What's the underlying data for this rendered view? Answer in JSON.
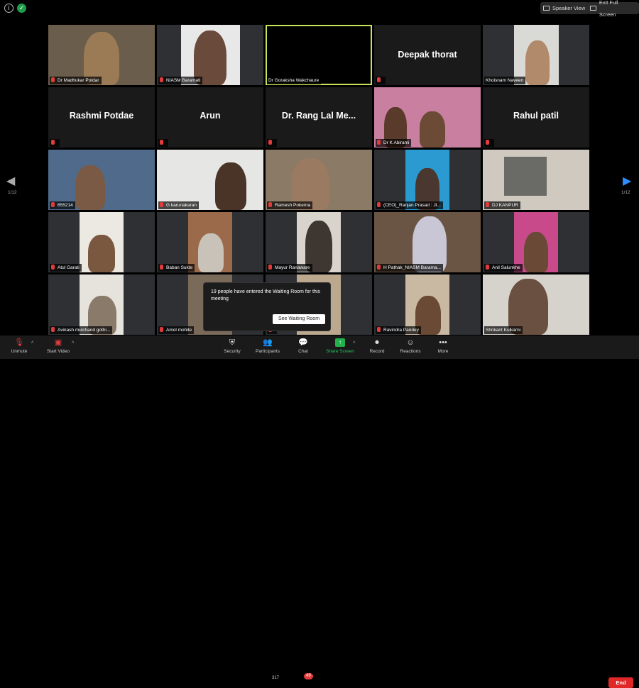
{
  "top": {
    "speaker_view": "Speaker View",
    "exit_full_screen": "Exit Full Screen"
  },
  "pagination": {
    "left_page": "1/12",
    "right_page": "1/12"
  },
  "tiles": [
    {
      "name": "Dr Madhukar Potdar",
      "kind": "video"
    },
    {
      "name": "NIASM Baramati",
      "kind": "video"
    },
    {
      "name": "Dr Goraksha Wakchaure",
      "kind": "black-active"
    },
    {
      "name": "Deepak thorat",
      "kind": "name-only"
    },
    {
      "name": "Khoisnam Naveen",
      "kind": "video"
    },
    {
      "name": "Rashmi Potdae",
      "kind": "name-only"
    },
    {
      "name": "Arun",
      "kind": "name-only"
    },
    {
      "name": "Dr. Rang Lal Me...",
      "kind": "name-only"
    },
    {
      "name": "Dr K Abirami",
      "kind": "video"
    },
    {
      "name": "Rahul patil",
      "kind": "name-only"
    },
    {
      "name": "655214",
      "kind": "video"
    },
    {
      "name": "G karunakaran",
      "kind": "video"
    },
    {
      "name": "Ramesh Pokerna",
      "kind": "video"
    },
    {
      "name": "(CEO)_Ranjan Prasad : JI...",
      "kind": "video"
    },
    {
      "name": "DJ KANPUR",
      "kind": "video"
    },
    {
      "name": "Atul Garati",
      "kind": "video"
    },
    {
      "name": "Baban Sukte",
      "kind": "video"
    },
    {
      "name": "Mayur Ranaware",
      "kind": "video"
    },
    {
      "name": "H Pathak_NIASM Barama...",
      "kind": "video"
    },
    {
      "name": "Anil Salunkhe",
      "kind": "video"
    },
    {
      "name": "Avinash mulchand gothi...",
      "kind": "video"
    },
    {
      "name": "Amol mohite",
      "kind": "video"
    },
    {
      "name": "",
      "kind": "video"
    },
    {
      "name": "Ravindra Pandey",
      "kind": "video"
    },
    {
      "name": "Shrikant Kulkarni",
      "kind": "video"
    }
  ],
  "waiting_room": {
    "message": "19 people have entered the Waiting Room for this meeting",
    "button": "See Waiting Room"
  },
  "toolbar": {
    "unmute": "Unmute",
    "start_video": "Start Video",
    "security": "Security",
    "participants": "Participants",
    "participants_count": "317",
    "chat": "Chat",
    "chat_badge": "49",
    "share_screen": "Share Screen",
    "record": "Record",
    "reactions": "Reactions",
    "more": "More",
    "end": "End"
  },
  "colors": {
    "active_speaker_border": "#c8e35a",
    "end_button": "#e02828",
    "share_green": "#22b14c",
    "nav_arrow_blue": "#2d8cff"
  }
}
